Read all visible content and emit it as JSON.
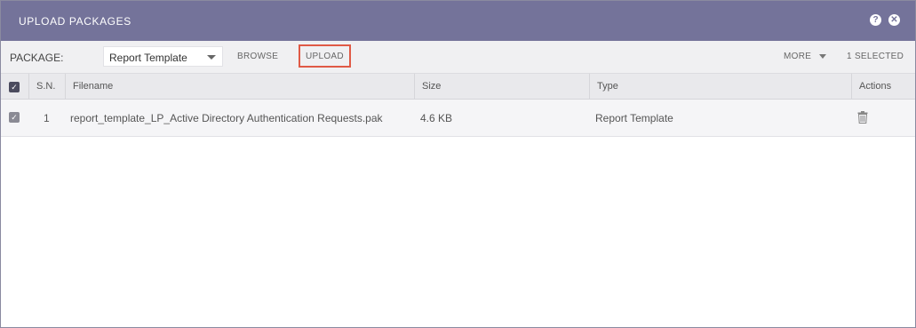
{
  "dialog": {
    "title": "UPLOAD PACKAGES",
    "help_icon": "help-circle-icon",
    "close_icon": "close-circle-icon"
  },
  "toolbar": {
    "package_label": "PACKAGE:",
    "package_select_value": "Report Template",
    "browse_label": "BROWSE",
    "upload_label": "UPLOAD",
    "more_label": "MORE",
    "selected_count": "1 SELECTED"
  },
  "table": {
    "columns": [
      "S.N.",
      "Filename",
      "Size",
      "Type",
      "Actions"
    ],
    "rows": [
      {
        "checked": true,
        "sn": "1",
        "filename": "report_template_LP_Active Directory Authentication Requests.pak",
        "size": "4.6 KB",
        "type": "Report Template",
        "action_icon": "trash-icon"
      }
    ]
  },
  "colors": {
    "titlebar": "#74739a",
    "highlight_box": "#e05a46",
    "header_checkbox": "#4b4b5e"
  }
}
